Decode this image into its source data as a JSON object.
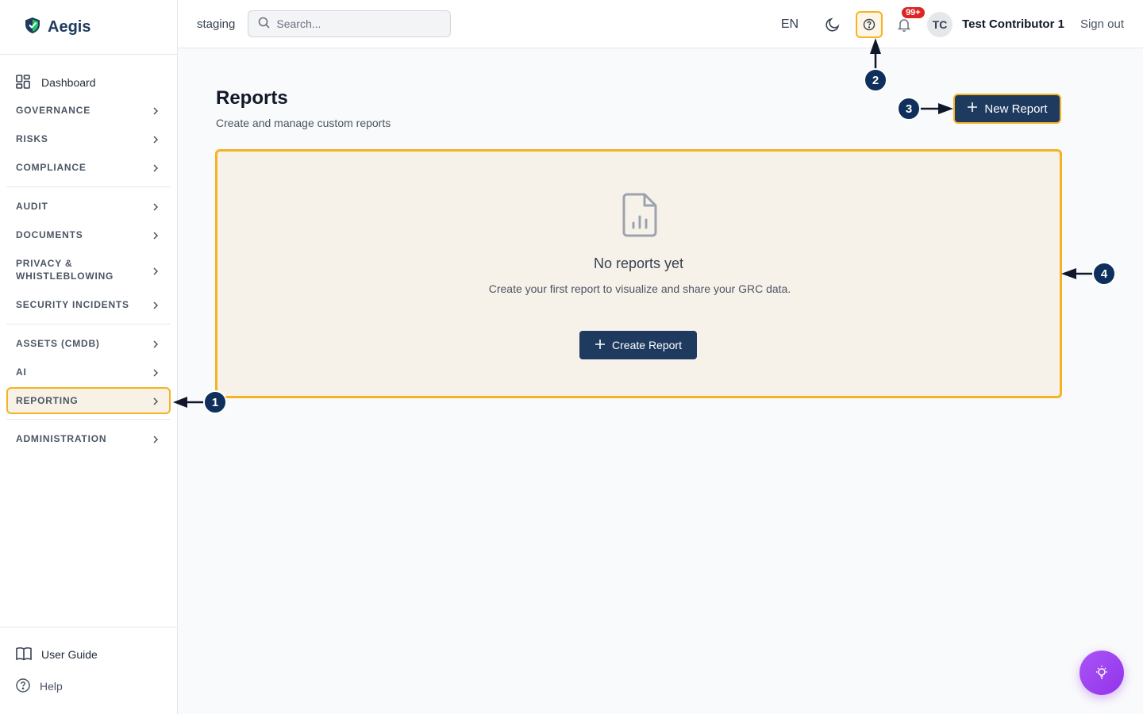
{
  "brand": {
    "name": "Aegis"
  },
  "sidebar": {
    "dashboard": "Dashboard",
    "groups": [
      [
        "GOVERNANCE",
        "RISKS",
        "COMPLIANCE"
      ],
      [
        "AUDIT",
        "DOCUMENTS",
        "PRIVACY & WHISTLEBLOWING",
        "SECURITY INCIDENTS"
      ],
      [
        "ASSETS (CMDB)",
        "AI",
        "REPORTING"
      ],
      [
        "ADMINISTRATION"
      ]
    ],
    "active": "REPORTING",
    "footer": {
      "user_guide": "User Guide",
      "help": "Help"
    }
  },
  "header": {
    "environment": "staging",
    "search_placeholder": "Search...",
    "language": "EN",
    "notifications_badge": "99+",
    "avatar_initials": "TC",
    "user_name": "Test Contributor 1",
    "sign_out": "Sign out"
  },
  "main": {
    "title": "Reports",
    "subtitle": "Create and manage custom reports",
    "new_report": "New Report",
    "empty": {
      "title": "No reports yet",
      "description": "Create your first report to visualize and share your GRC data.",
      "create_button": "Create Report"
    }
  },
  "callouts": [
    "1",
    "2",
    "3",
    "4"
  ],
  "colors": {
    "primary": "#1e3a5f",
    "highlight": "#f5b324",
    "callout": "#0f2f5c",
    "badge": "#dc2626",
    "fab": "#9333ea"
  }
}
